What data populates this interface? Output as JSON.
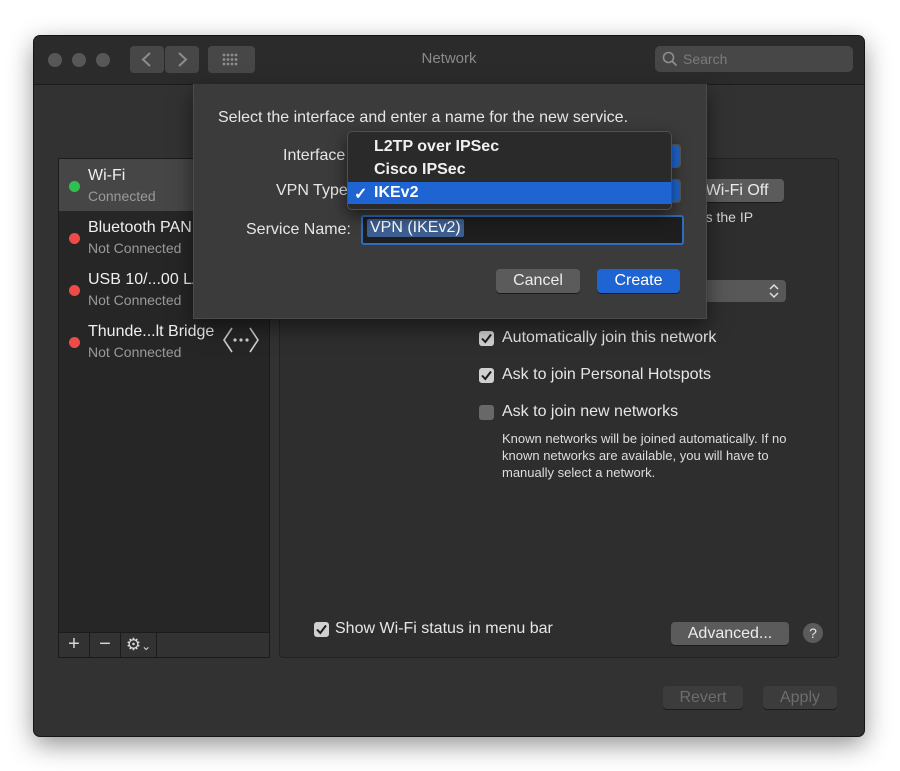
{
  "window": {
    "title": "Network"
  },
  "toolbar": {
    "search_placeholder": "Search"
  },
  "sidebar": {
    "items": [
      {
        "name": "Wi-Fi",
        "status": "Connected",
        "status_color": "#2fc150",
        "selected": true
      },
      {
        "name": "Bluetooth PAN",
        "status": "Not Connected",
        "status_color": "#ee4b46"
      },
      {
        "name": "USB 10/...00 LAN",
        "status": "Not Connected",
        "status_color": "#ee4b46"
      },
      {
        "name": "Thunde...lt Bridge",
        "status": "Not Connected",
        "status_color": "#ee4b46"
      }
    ],
    "add_label": "+",
    "remove_label": "−",
    "gear_label": "⚙",
    "menu_chevron": "⌄"
  },
  "panel": {
    "wifi_off_label": "Wi-Fi Off",
    "partial_text": "has the IP",
    "auto_join_label": "Automatically join this network",
    "auto_join_checked": true,
    "hotspots_label": "Ask to join Personal Hotspots",
    "hotspots_checked": true,
    "new_networks_label": "Ask to join new networks",
    "new_networks_checked": false,
    "note": "Known networks will be joined automatically. If no known networks are available, you will have to manually select a network.",
    "show_status_label": "Show Wi-Fi status in menu bar",
    "show_status_checked": true,
    "advanced_label": "Advanced...",
    "help_label": "?"
  },
  "footer": {
    "revert_label": "Revert",
    "apply_label": "Apply"
  },
  "sheet": {
    "instruction": "Select the interface and enter a name for the new service.",
    "interface_label": "Interface",
    "vpn_type_label": "VPN Type",
    "service_name_label": "Service Name:",
    "service_name_value": "VPN (IKEv2)",
    "cancel_label": "Cancel",
    "create_label": "Create"
  },
  "vpn_menu": {
    "options": [
      "L2TP over IPSec",
      "Cisco IPSec",
      "IKEv2"
    ],
    "selected": "IKEv2",
    "checkmark": "✓"
  },
  "colors": {
    "accent": "#1f64d3",
    "window_bg": "#323232",
    "sidebar_bg": "#262626"
  }
}
